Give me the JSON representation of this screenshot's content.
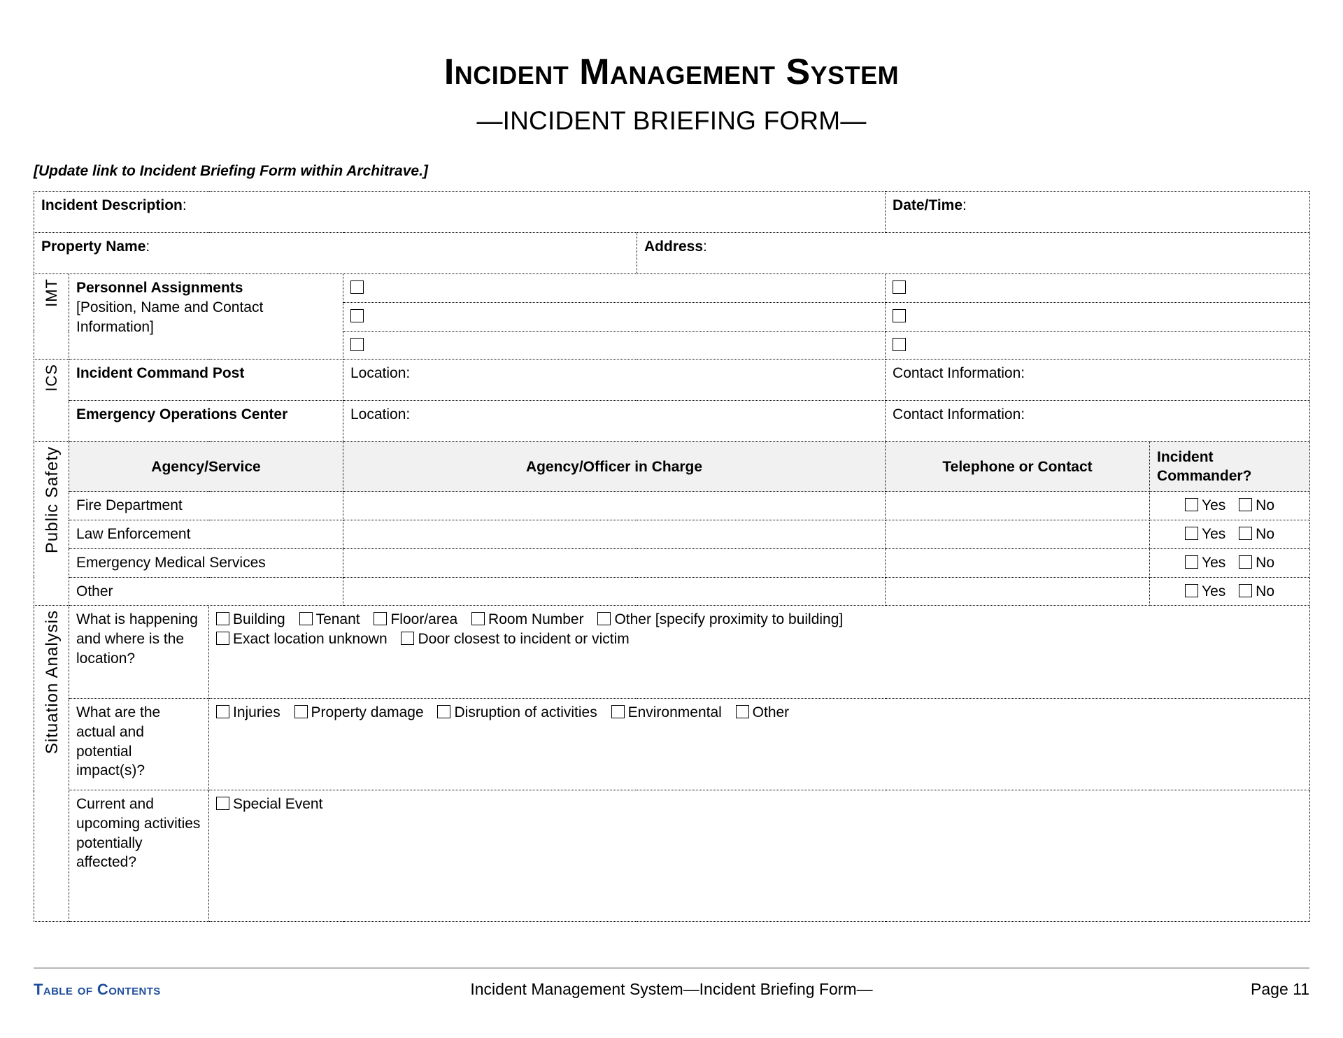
{
  "document": {
    "title": "Incident Management System",
    "subtitle": "—INCIDENT BRIEFING FORM—",
    "editor_note": "[Update link to Incident Briefing Form within Architrave.]"
  },
  "top_fields": {
    "incident_description_label": "Incident Description",
    "incident_description_colon": ":",
    "datetime_label": "Date/Time",
    "datetime_colon": ":",
    "property_name_label": "Property Name",
    "property_name_colon": ":",
    "address_label": "Address",
    "address_colon": ":"
  },
  "imt": {
    "side_label": "IMT",
    "heading": "Personnel Assignments",
    "subheading_line1": "[Position, Name and Contact",
    "subheading_line2": "Information]",
    "rows": 3
  },
  "ics": {
    "side_label": "ICS",
    "rows": [
      {
        "label": "Incident Command Post",
        "location_label": "Location:",
        "contact_label": "Contact Information:"
      },
      {
        "label": "Emergency Operations Center",
        "location_label": "Location:",
        "contact_label": "Contact Information:"
      }
    ]
  },
  "public_safety": {
    "side_label": "Public Safety",
    "columns": [
      "Agency/Service",
      "Agency/Officer in Charge",
      "Telephone or Contact",
      "Incident Commander?"
    ],
    "yes_label": "Yes",
    "no_label": "No",
    "rows": [
      "Fire Department",
      "Law Enforcement",
      "Emergency Medical Services",
      "Other"
    ]
  },
  "situation_analysis": {
    "side_label": "Situation Analysis",
    "questions": [
      {
        "prompt": "What is happening and where is the location?",
        "option_lines": [
          [
            "Building",
            "Tenant",
            "Floor/area",
            "Room Number",
            "Other [specify proximity to building]"
          ],
          [
            "Exact location unknown",
            "Door closest to incident or victim"
          ]
        ]
      },
      {
        "prompt": "What are the actual and potential impact(s)?",
        "option_lines": [
          [
            "Injuries",
            "Property damage",
            "Disruption of activities",
            "Environmental",
            "Other"
          ]
        ]
      },
      {
        "prompt": "Current and upcoming activities potentially affected?",
        "option_lines": [
          [
            "Special Event"
          ]
        ]
      }
    ]
  },
  "footer": {
    "toc_link": "Table of Contents",
    "center_text": "Incident Management System—Incident Briefing Form—",
    "page_label": "Page 11"
  },
  "colors": {
    "link_blue": "#1f4e9c",
    "header_gray": "#f1f1f1",
    "side_gray": "#efefef",
    "rule_gray": "#b7b7b7"
  }
}
